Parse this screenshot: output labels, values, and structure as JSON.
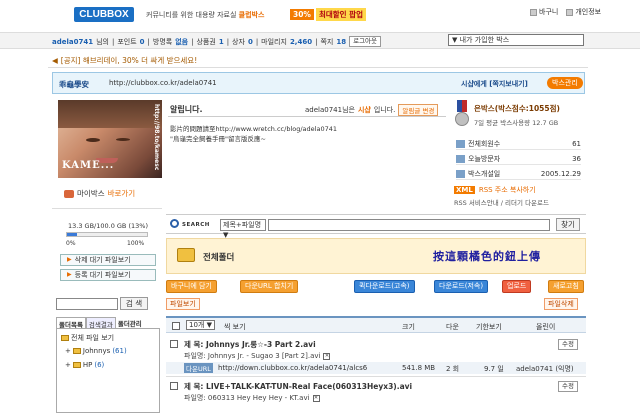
{
  "header": {
    "logo": "CLUBBOX",
    "slogan_prefix": "커뮤니티를 위한 대용량 자료실 ",
    "slogan_highlight": "클럽박스",
    "promo_pct": "30%",
    "promo_text": "최대할인 팝업",
    "links": [
      "바구니",
      "개인정보"
    ]
  },
  "userbar": {
    "username": "adela0741",
    "suffix": "님의",
    "points_label": "포인트",
    "points": "0",
    "gifts_label": "방명록",
    "gifts": "없음",
    "products_label": "상품권",
    "products": "1",
    "box_label": "상자",
    "box": "0",
    "mileage_label": "마일리지",
    "mileage": "2,460",
    "notes_label": "쪽지",
    "notes": "18",
    "logout": "로그아웃",
    "box_select": "▼ 내가 가입한 박스"
  },
  "notice": "[공지] 해브리데이, 30% 더 싸게 받으세요!",
  "blog": {
    "title": "乖龜學安",
    "url": "http://clubbox.co.kr/adela0741",
    "shoot_label": "시샵에게 [쪽지보내기]",
    "manage": "박스관리"
  },
  "photo": {
    "caption": "KAME...",
    "side_text": "http://98.to/kamesc"
  },
  "mybox": {
    "label": "마이박스",
    "go": "바로가기"
  },
  "storage": {
    "text": "13.3 GB/100.0 GB (13%)",
    "min": "0%",
    "max": "100%",
    "percent": 13
  },
  "left_buttons": [
    "삭제 대기 파일보기",
    "등록 대기 파일보기"
  ],
  "left_search_btn": "검 색",
  "tabs": [
    "폴더목록",
    "검색결과",
    "폴더관리"
  ],
  "folders": [
    {
      "name": "전체 파일 보기",
      "count": ""
    },
    {
      "name": "Johnnys",
      "count": "(61)"
    },
    {
      "name": "HP",
      "count": "(6)"
    }
  ],
  "intro": {
    "heading": "알립니다.",
    "owner": "adela0741님은",
    "owner_role": "시샵",
    "owner_suffix": "입니다.",
    "edit_btn": "알림글 변경",
    "text": "影片的問題請至http://www.wretch.cc/blog/adela0741\n\"烏龜完全飼養手冊\"留言版反應~"
  },
  "box_info": {
    "title": "은박스(박스점수:1055점)",
    "sub": "7일 평균 박스사용량  12.7 GB",
    "rows": [
      {
        "k": "전체회원수",
        "v": "61"
      },
      {
        "k": "오늘방문자",
        "v": "36"
      },
      {
        "k": "박스개설일",
        "v": "2005.12.29"
      }
    ],
    "xml": "XML",
    "rss": "RSS 주소 복사하기",
    "rss_line": "RSS 서비스안내 / 리더기 다운로드"
  },
  "search": {
    "label": "SEARCH",
    "select": "제목+파일명",
    "button": "찾기"
  },
  "all_folder": {
    "title": "전체폴더",
    "note": "按這顆橘色的鈕上傳"
  },
  "actions": {
    "basket": "바구니에 담기",
    "download_url": "다운URL 합치기",
    "quick_download": "퀵다운로드(고속)",
    "download": "다운로드(저속)",
    "upload": "업로드",
    "refresh": "새로고침",
    "view_files": "파일보기",
    "delete_files": "파일삭제"
  },
  "table": {
    "page_size": "10개",
    "view_suffix": "씩 보기",
    "headers": [
      "크기",
      "다운",
      "기한보기",
      "올린이"
    ]
  },
  "rows": [
    {
      "title_label": "제 목",
      "title": "Johnnys Jr.롱☆-3 Part 2.avi",
      "file_label": "파일명",
      "file": "Johnnys Jr. - Sugao 3 [Part 2].avi",
      "url": "http://down.clubbox.co.kr/adela0741/alcs6",
      "url_tag": "다운URL",
      "size": "541.8 MB",
      "down": "2 회",
      "date": "9.7 일",
      "uploader": "adela0741 (익명)",
      "fix": "수정"
    },
    {
      "title_label": "제 목",
      "title": "LIVE+TALK-KAT-TUN-Real Face(060313Heyx3).avi",
      "file_label": "파일명",
      "file": "060313 Hey Hey Hey - KT.avi",
      "fix": "수정"
    }
  ]
}
